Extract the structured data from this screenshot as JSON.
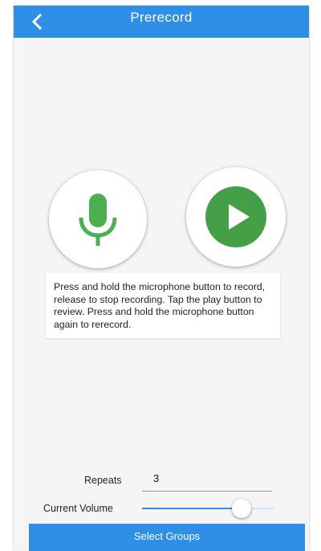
{
  "header": {
    "title": "Prerecord",
    "back_icon": "chevron-left-icon"
  },
  "controls": {
    "mic_icon": "microphone-icon",
    "play_icon": "play-icon"
  },
  "instructions": {
    "text": "Press and hold the microphone button to record, release to stop recording. Tap the play button to review. Press and hold the microphone button again to rerecord."
  },
  "settings": {
    "repeats_label": "Repeats",
    "repeats_value": "3",
    "volume_label": "Current Volume",
    "volume_level": 0.75
  },
  "footer": {
    "select_groups_label": "Select Groups"
  },
  "colors": {
    "primary": "#2f8ee6",
    "mic_green": "#4caf50",
    "play_green": "#43a047",
    "background": "#f5f5f5"
  }
}
